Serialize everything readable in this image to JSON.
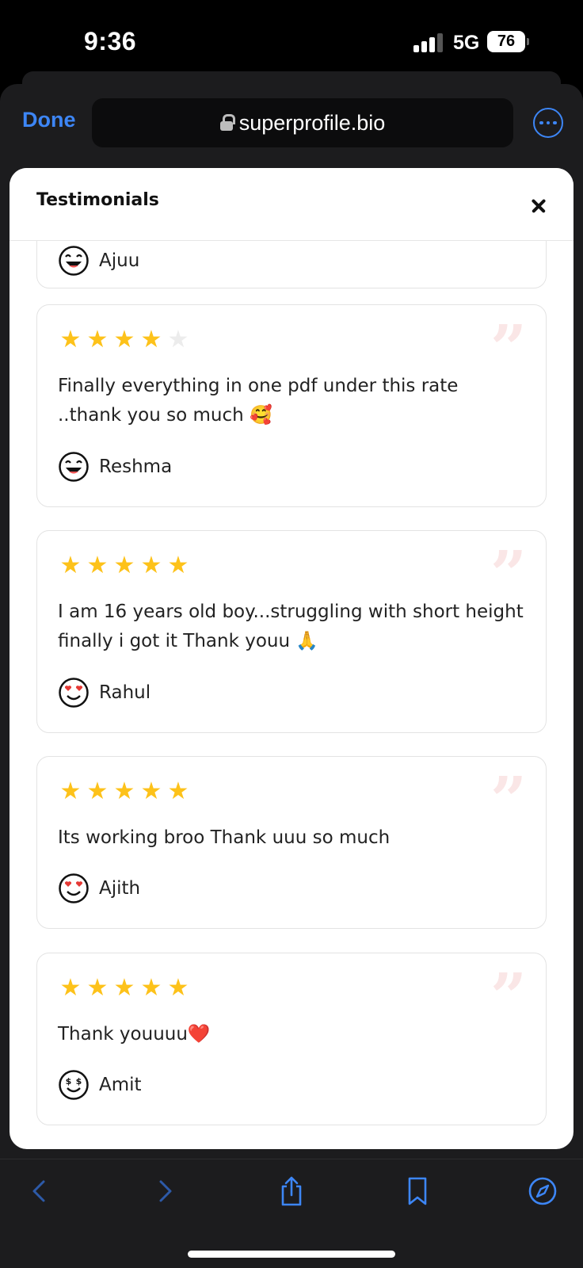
{
  "status_bar": {
    "time": "9:36",
    "network": "5G",
    "battery": "76"
  },
  "browser": {
    "done_label": "Done",
    "url": "superprofile.bio"
  },
  "modal": {
    "title": "Testimonials",
    "partial_reviewer": "Ajuu",
    "testimonials": [
      {
        "rating": 4,
        "text": "Finally everything in one pdf under this rate ..thank you so much 🥰",
        "name": "Reshma",
        "avatar": "grinning-face"
      },
      {
        "rating": 5,
        "text": "I am 16 years old boy...struggling with short height finally i got it Thank youu 🙏",
        "name": "Rahul",
        "avatar": "heart-eyes-face"
      },
      {
        "rating": 5,
        "text": "Its working broo Thank uuu so much",
        "name": "Ajith",
        "avatar": "heart-eyes-face"
      },
      {
        "rating": 5,
        "text": "Thank youuuu❤️",
        "name": "Amit",
        "avatar": "dollar-eyes-face"
      }
    ]
  },
  "colors": {
    "accent": "#3d86f6",
    "star": "#fdc21a",
    "quote": "#fae6e6"
  }
}
